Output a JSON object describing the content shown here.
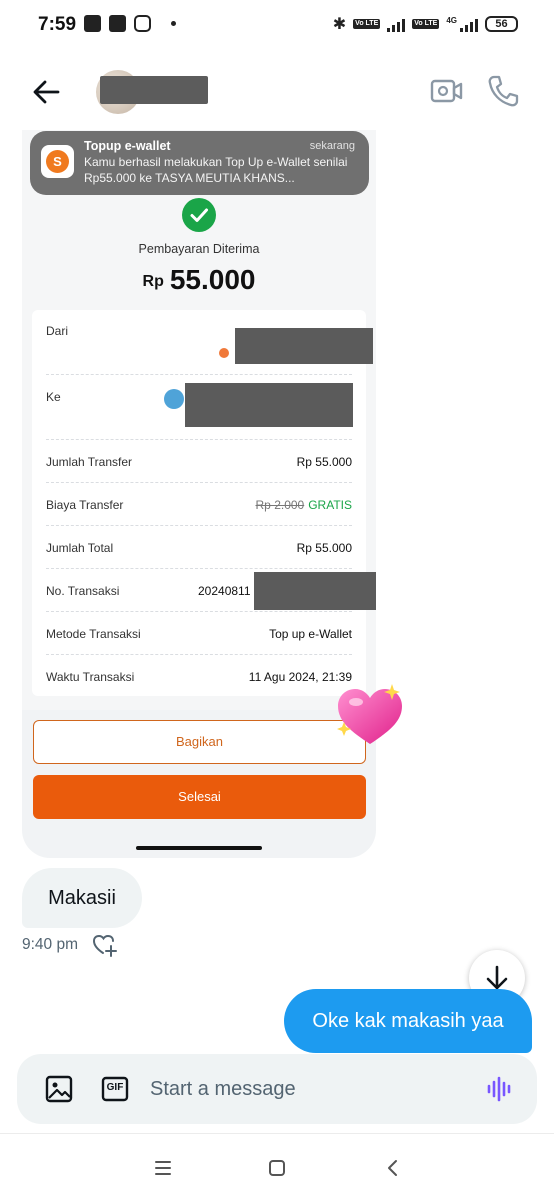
{
  "status_bar": {
    "time": "7:59",
    "network": "4G",
    "battery": "56",
    "volte_label": "Vo LTE"
  },
  "header": {
    "back_icon": "arrow-left-icon",
    "video_icon": "video-camera-icon",
    "call_icon": "phone-icon"
  },
  "notification": {
    "title": "Topup e-wallet",
    "time": "sekarang",
    "body": "Kamu berhasil melakukan Top Up e-Wallet senilai Rp55.000 ke TASYA MEUTIA KHANS...",
    "app_icon_letter": "S"
  },
  "receipt": {
    "status": "Pembayaran Diterima",
    "currency": "Rp",
    "amount": "55.000",
    "rows": {
      "from_label": "Dari",
      "to_label": "Ke",
      "transfer_amount_label": "Jumlah Transfer",
      "transfer_amount_value": "Rp 55.000",
      "fee_label": "Biaya Transfer",
      "fee_original": "Rp 2.000",
      "fee_value": "GRATIS",
      "total_label": "Jumlah Total",
      "total_value": "Rp 55.000",
      "tx_no_label": "No. Transaksi",
      "tx_no_value": "20240811",
      "method_label": "Metode Transaksi",
      "method_value": "Top up e-Wallet",
      "time_label": "Waktu Transaksi",
      "time_value": "11 Agu 2024, 21:39"
    },
    "share_button": "Bagikan",
    "done_button": "Selesai"
  },
  "messages": {
    "incoming_text": "Makasii",
    "incoming_time": "9:40 pm",
    "outgoing_text": "Oke kak makasih yaa"
  },
  "composer": {
    "placeholder": "Start a message",
    "gif_label": "GIF"
  },
  "colors": {
    "brand_blue": "#1d9bf0",
    "success_green": "#1aa548",
    "orange": "#ea5b0c",
    "voice_purple": "#7856ff"
  }
}
